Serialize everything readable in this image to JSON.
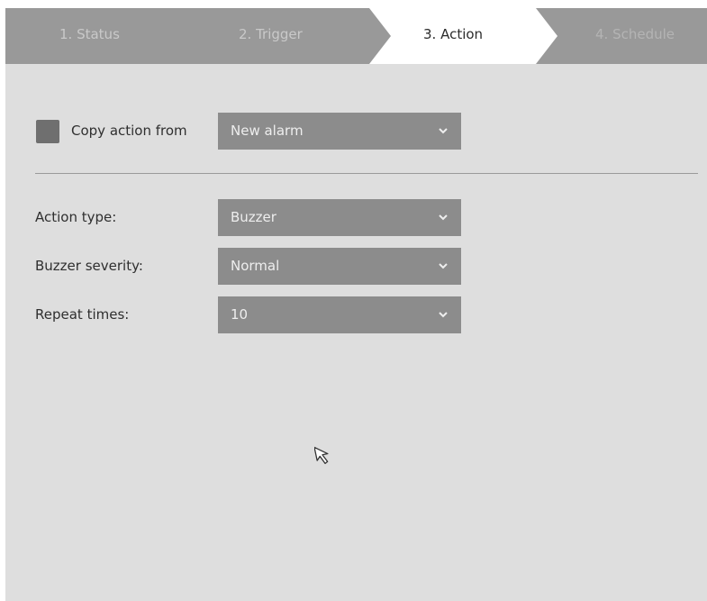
{
  "steps": [
    {
      "label": "1. Status",
      "state": "inactive"
    },
    {
      "label": "2. Trigger",
      "state": "inactive"
    },
    {
      "label": "3. Action",
      "state": "active"
    },
    {
      "label": "4. Schedule",
      "state": "disabled"
    }
  ],
  "copy_action": {
    "label": "Copy action from",
    "checked": false,
    "selected": "New alarm"
  },
  "fields": {
    "action_type": {
      "label": "Action type:",
      "value": "Buzzer"
    },
    "buzzer_severity": {
      "label": "Buzzer severity:",
      "value": "Normal"
    },
    "repeat_times": {
      "label": "Repeat times:",
      "value": "10"
    }
  },
  "colors": {
    "panel_bg": "#dedede",
    "step_inactive_bg": "#999999",
    "step_active_bg": "#ffffff",
    "select_bg": "#8c8c8c",
    "checkbox": "#6f6f6f"
  },
  "icons": {
    "dropdown": "chevron-down-icon",
    "cursor": "mouse-pointer-icon"
  }
}
